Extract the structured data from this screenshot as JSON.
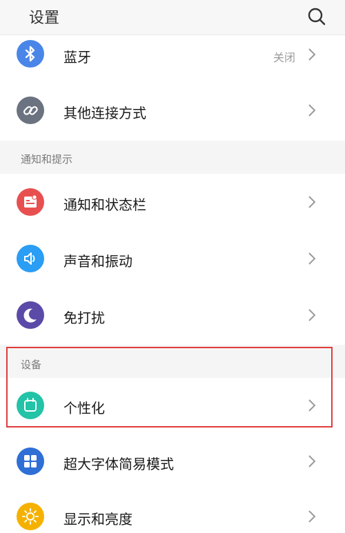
{
  "header": {
    "title": "设置",
    "search_icon": "search-icon"
  },
  "rows": {
    "bluetooth": {
      "label": "蓝牙",
      "value": "关闭",
      "icon": "bluetooth-icon",
      "color": "#4a86e8"
    },
    "other_connections": {
      "label": "其他连接方式",
      "icon": "link-icon",
      "color": "#6b7280"
    },
    "notification_bar": {
      "label": "通知和状态栏",
      "icon": "notification-icon",
      "color": "#e85050"
    },
    "sound_vibration": {
      "label": "声音和振动",
      "icon": "speaker-icon",
      "color": "#2a9df4"
    },
    "do_not_disturb": {
      "label": "免打扰",
      "icon": "moon-icon",
      "color": "#5b4aa8"
    },
    "personalization": {
      "label": "个性化",
      "icon": "theme-icon",
      "color": "#22c3a6"
    },
    "simple_mode": {
      "label": "超大字体简易模式",
      "icon": "grid-icon",
      "color": "#2f6fd6"
    },
    "display_brightness": {
      "label": "显示和亮度",
      "icon": "sun-icon",
      "color": "#f5b100"
    }
  },
  "sections": {
    "notifications": "通知和提示",
    "device": "设备"
  },
  "highlight_color": "#e03b3b"
}
